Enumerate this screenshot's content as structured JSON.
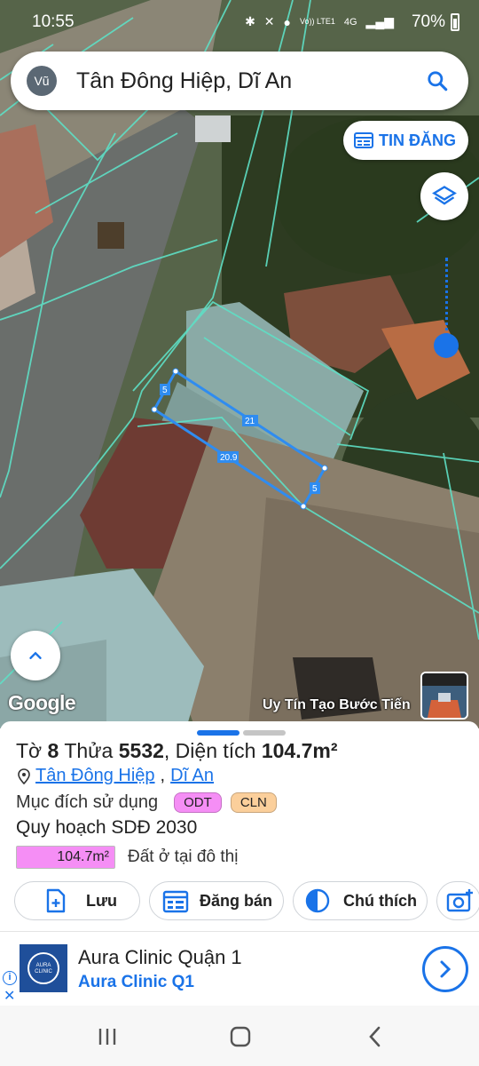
{
  "status_bar": {
    "time": "10:55",
    "battery": "70%",
    "network_label": "Vo)) LTE1",
    "network_type": "4G"
  },
  "search": {
    "avatar": "Vũ",
    "query": "Tân Đông Hiệp, Dĩ An",
    "icon": "search-icon"
  },
  "map": {
    "tin_dang_label": "TIN ĐĂNG",
    "google_logo": "Google",
    "attribution": "Uy Tín Tạo Bước Tiến",
    "parcel_edges": [
      "5",
      "21",
      "20.9",
      "5"
    ]
  },
  "parcel": {
    "sheet_label": "Tờ",
    "sheet_no": "8",
    "plot_label": "Thửa",
    "plot_no": "5532",
    "area_label": ", Diện tích",
    "area_value": "104.7m²",
    "ward": "Tân Đông Hiệp",
    "city": "Dĩ An",
    "purpose_label": "Mục đích sử dụng",
    "purpose_tags": [
      "ODT",
      "CLN"
    ],
    "plan_label": "Quy hoạch SDĐ 2030",
    "plan_area": "104.7m²",
    "plan_type": "Đất ở tại đô thị"
  },
  "actions": {
    "save": "Lưu",
    "sell": "Đăng bán",
    "legend": "Chú thích"
  },
  "ad": {
    "title": "Aura Clinic Quận 1",
    "subtitle": "Aura Clinic Q1",
    "logo_text": "AURA CLINIC"
  },
  "colors": {
    "accent": "#1a73e8",
    "odt": "#f58ef5",
    "cln": "#fbcf9b",
    "parcel_line": "#5ee0c6"
  }
}
